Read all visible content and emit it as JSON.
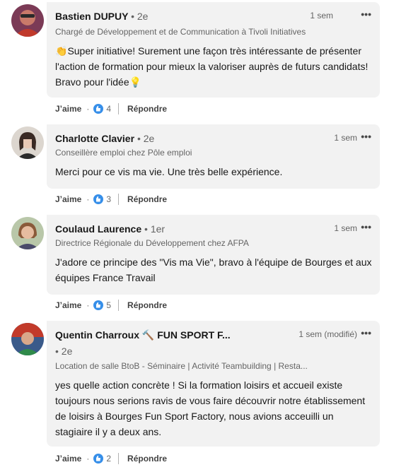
{
  "comments": [
    {
      "name": "Bastien DUPUY",
      "degree": "• 2e",
      "headline": "Chargé de Développement et de Communication à Tivoli Initiatives",
      "time": "1 sem",
      "emoji_start": "👏",
      "text": "Super initiative! Surement une façon très intéressante de présenter l'action de formation pour mieux la valoriser auprès de futurs candidats! Bravo pour l'idée",
      "emoji_end": "💡",
      "like_label": "J’aime",
      "reactions": "4",
      "reply_label": "Répondre",
      "avatar_colors": [
        "#7b3a56",
        "#c97a6a"
      ]
    },
    {
      "name": "Charlotte Clavier",
      "degree": "• 2e",
      "headline": "Conseillère emploi chez Pôle emploi",
      "time": "1 sem",
      "text": "Merci pour ce vis ma vie. Une très belle expérience.",
      "like_label": "J’aime",
      "reactions": "3",
      "reply_label": "Répondre",
      "avatar_colors": [
        "#dcd6cf",
        "#3a2a24"
      ]
    },
    {
      "name": "Coulaud Laurence",
      "degree": "• 1er",
      "headline": "Directrice Régionale du Développement chez AFPA",
      "time": "1 sem",
      "text": "J'adore ce principe des \"Vis ma Vie\", bravo à l'équipe de Bourges et aux équipes France Travail",
      "like_label": "J’aime",
      "reactions": "5",
      "reply_label": "Répondre",
      "avatar_colors": [
        "#b9c7a9",
        "#8a5a3a"
      ]
    },
    {
      "name": "Quentin Charroux",
      "name_suffix": "🔨 FUN SPORT F...",
      "degree": "• 2e",
      "headline": "Location de salle BtoB - Séminaire | Activité Teambuilding | Resta...",
      "time": "1 sem (modifié)",
      "text": "yes quelle action concrète ! Si la formation loisirs et accueil existe toujours nous serions ravis de vous faire découvrir notre établissement de loisirs à Bourges Fun Sport Factory, nous avions acceuilli un stagiaire il y a deux ans.",
      "like_label": "J’aime",
      "reactions": "2",
      "reply_label": "Répondre",
      "avatar_colors": [
        "#3a5a8a",
        "#c23a2a"
      ]
    }
  ],
  "more_label": "•••",
  "dot_separator": "·",
  "colors": {
    "bubble": "#f2f2f2",
    "reaction": "#378fe9"
  }
}
